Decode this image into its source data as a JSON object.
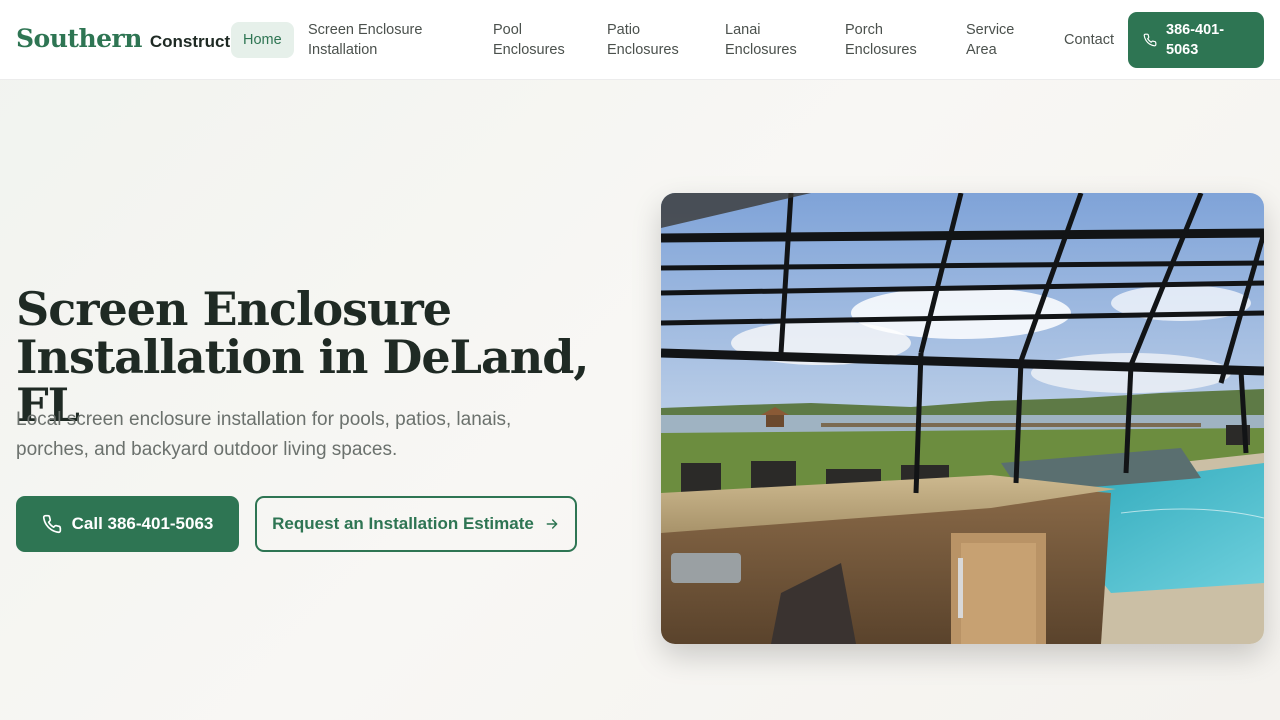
{
  "brand": {
    "mark": "Southern",
    "word": "Construction"
  },
  "nav": {
    "items": [
      {
        "label": "Home",
        "active": true
      },
      {
        "label": "Screen Enclosure\nInstallation"
      },
      {
        "label": "Pool\nEnclosures"
      },
      {
        "label": "Patio\nEnclosures"
      },
      {
        "label": "Lanai\nEnclosures"
      },
      {
        "label": "Porch\nEnclosures"
      },
      {
        "label": "Service\nArea"
      },
      {
        "label": "Contact"
      }
    ],
    "cta_label": "386-401-5063",
    "cta_icon": "phone-icon"
  },
  "hero": {
    "title": "Screen Enclosure Installation in DeLand, FL",
    "subtitle": "Local screen enclosure installation for pools, patios, lanais, porches, and backyard outdoor living spaces.",
    "primary_button": "Call 386-401-5063",
    "secondary_button": "Request an Installation Estimate",
    "photo_subject": "screened pool enclosure with outdoor kitchen overlooking a lake"
  },
  "colors": {
    "accent": "#2e7553",
    "accent_light": "#e6f0ea",
    "text_dark": "#1f2a24",
    "text_muted": "#6b716d"
  }
}
